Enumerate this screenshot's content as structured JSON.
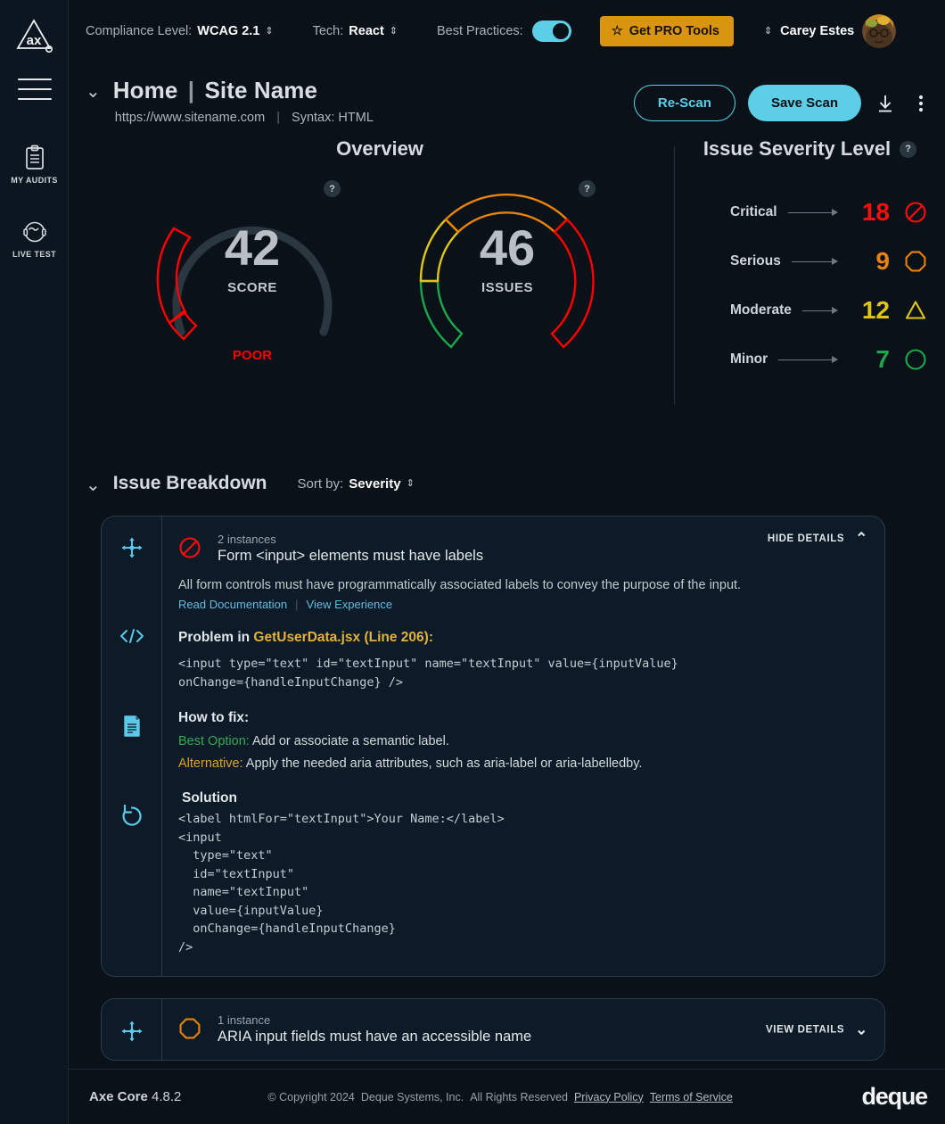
{
  "brand": {
    "logo_alt": "axe-logo",
    "footer_brand": "deque"
  },
  "sidebar": {
    "items": [
      {
        "icon": "clipboard-icon",
        "label": "MY AUDITS"
      },
      {
        "icon": "headset-icon",
        "label": "LIVE TEST"
      }
    ]
  },
  "topbar": {
    "compliance_label": "Compliance Level:",
    "compliance_value": "WCAG 2.1",
    "tech_label": "Tech:",
    "tech_value": "React",
    "best_practices_label": "Best Practices:",
    "best_practices_on": true,
    "pro_button": "Get PRO Tools",
    "user_name": "Carey Estes"
  },
  "page": {
    "title_primary": "Home",
    "title_separator": "|",
    "title_secondary": "Site Name",
    "url": "https://www.sitename.com",
    "syntax": "Syntax: HTML",
    "rescan_button": "Re-Scan",
    "savescan_button": "Save Scan"
  },
  "overview": {
    "heading": "Overview",
    "score": {
      "value": "42",
      "caption": "SCORE",
      "rating": "POOR",
      "rating_color": "#ff0000",
      "percent": 42
    },
    "issues": {
      "value": "46",
      "caption": "ISSUES"
    }
  },
  "severity": {
    "heading": "Issue Severity Level",
    "rows": [
      {
        "name": "Critical",
        "count": "18",
        "color": "#ff0d0d",
        "shape": "no-entry-icon"
      },
      {
        "name": "Serious",
        "count": "9",
        "color": "#e8830c",
        "shape": "octagon-icon"
      },
      {
        "name": "Moderate",
        "count": "12",
        "color": "#e0c416",
        "shape": "triangle-icon"
      },
      {
        "name": "Minor",
        "count": "7",
        "color": "#1aa84a",
        "shape": "circle-icon"
      }
    ]
  },
  "breakdown": {
    "heading": "Issue Breakdown",
    "sort_label": "Sort by:",
    "sort_value": "Severity",
    "cards": [
      {
        "instances": "2 instances",
        "title": "Form <input> elements must have labels",
        "severity_shape": "no-entry-icon",
        "severity_color": "#ff0d0d",
        "toggle_label": "HIDE DETAILS",
        "expanded": true,
        "description": "All form controls must have programmatically associated labels to convey the purpose of the input.",
        "link_doc": "Read Documentation",
        "link_experience": "View Experience",
        "problem_label": "Problem in",
        "problem_file": "GetUserData.jsx (Line 206):",
        "problem_code": "<input type=\"text\" id=\"textInput\" name=\"textInput\" value={inputValue}\nonChange={handleInputChange} />",
        "howto_label": "How to fix:",
        "best_label": "Best Option:",
        "best_text": "Add or associate a semantic label.",
        "alt_label": "Alternative:",
        "alt_text": "Apply the needed aria attributes, such as aria-label or aria-labelledby.",
        "solution_label": "Solution",
        "solution_code": "<label htmlFor=\"textInput\">Your Name:</label>\n<input\n  type=\"text\"\n  id=\"textInput\"\n  name=\"textInput\"\n  value={inputValue}\n  onChange={handleInputChange}\n/>",
        "rail_icons": [
          "move-icon",
          "code-icon",
          "document-icon",
          "undo-icon"
        ]
      },
      {
        "instances": "1 instance",
        "title": "ARIA input fields must have an accessible name",
        "severity_shape": "octagon-icon",
        "severity_color": "#e8830c",
        "toggle_label": "VIEW DETAILS",
        "expanded": false,
        "rail_icons": [
          "move-icon"
        ]
      }
    ]
  },
  "footer": {
    "engine_name": "Axe Core",
    "engine_version": "4.8.2",
    "copyright": "© Copyright 2024",
    "company": "Deque Systems, Inc.",
    "rights": "All Rights Reserved",
    "privacy": "Privacy Policy",
    "terms": "Terms of Service"
  },
  "colors": {
    "accent": "#5ccfe6",
    "pro": "#d99510",
    "link": "#5fbce0"
  }
}
